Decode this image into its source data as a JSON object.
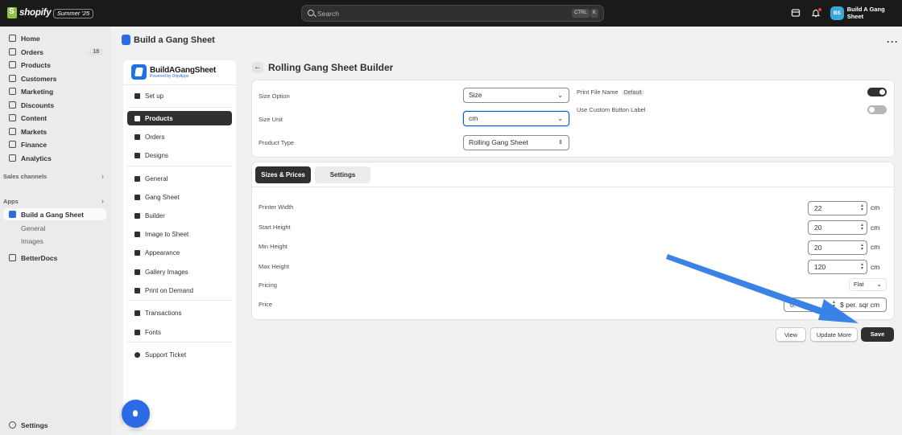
{
  "topbar": {
    "logo_text": "shopify",
    "edition": "Summer '25",
    "search_placeholder": "Search",
    "shortcut_ctrl": "CTRL",
    "shortcut_k": "K",
    "store_initials": "BS",
    "store_name": "Build A Gang Sheet"
  },
  "sidebar": {
    "items": [
      {
        "label": "Home",
        "icon": "home-icon"
      },
      {
        "label": "Orders",
        "icon": "orders-icon",
        "badge": "18"
      },
      {
        "label": "Products",
        "icon": "tag-icon"
      },
      {
        "label": "Customers",
        "icon": "person-icon"
      },
      {
        "label": "Marketing",
        "icon": "target-icon"
      },
      {
        "label": "Discounts",
        "icon": "discount-icon"
      },
      {
        "label": "Content",
        "icon": "content-icon"
      },
      {
        "label": "Markets",
        "icon": "globe-icon"
      },
      {
        "label": "Finance",
        "icon": "bank-icon"
      },
      {
        "label": "Analytics",
        "icon": "chart-icon"
      }
    ],
    "sales_channels": "Sales channels",
    "apps": "Apps",
    "app_active": "Build a Gang Sheet",
    "app_sub_general": "General",
    "app_sub_images": "Images",
    "betterdocs": "BetterDocs",
    "settings": "Settings"
  },
  "page": {
    "title": "Build a Gang Sheet",
    "more": "···"
  },
  "appnav": {
    "brand_name": "BuildAGangSheet",
    "brand_sub": "Powered by DripApps",
    "items": [
      "Set up",
      "Products",
      "Orders",
      "Designs",
      "General",
      "Gang Sheet",
      "Builder",
      "Image to Sheet",
      "Appearance",
      "Gallery Images",
      "Print on Demand",
      "Transactions",
      "Fonts",
      "Support Ticket"
    ]
  },
  "main": {
    "title": "Rolling Gang Sheet Builder",
    "size_option_label": "Size Option",
    "size_option_value": "Size",
    "size_unit_label": "Size Unit",
    "size_unit_value": "cm",
    "product_type_label": "Product Type",
    "product_type_value": "Rolling Gang Sheet",
    "print_file_name_label": "Print File Name",
    "print_file_name_pill": "Default",
    "custom_button_label": "Use Custom Button Label",
    "print_file_toggle": true,
    "custom_button_toggle": false,
    "tabs": [
      "Sizes & Prices",
      "Settings"
    ],
    "fields": [
      {
        "label": "Printer Width",
        "value": "22",
        "unit": "cm"
      },
      {
        "label": "Start Height",
        "value": "20",
        "unit": "cm"
      },
      {
        "label": "Min Height",
        "value": "20",
        "unit": "cm"
      },
      {
        "label": "Max Height",
        "value": "120",
        "unit": "cm"
      }
    ],
    "pricing_label": "Pricing",
    "pricing_value": "Flat",
    "price_label": "Price",
    "price_value": "0.",
    "price_unit": "$ per. sqr cm",
    "btn_view": "View",
    "btn_update_more": "Update More",
    "btn_save": "Save"
  },
  "colors": {
    "topbar": "#1a1a1a",
    "brand_blue": "#2d6be5",
    "primary_button": "#303030",
    "annotation_arrow": "#3b82e6"
  }
}
